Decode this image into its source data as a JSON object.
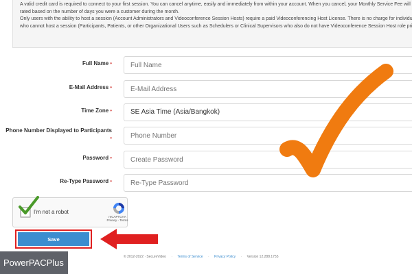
{
  "notice": {
    "line1": "A valid credit card is required to connect to your first session. You can cancel anytime, easily and immediately from within your account. When you cancel, your Monthly Service Fee will",
    "line2": "rated based on the number of days you were a customer during the month.",
    "line3": "Only users with the ability to host a session (Account Administrators and Videoconference Session Hosts) require a paid Videoconferencing Host License. There is no charge for individua",
    "line4": "who cannot host a session (Participants, Patients, or other Organizational Users such as Schedulers or Clinical Supervisors who also do not have Videoconference Session Host role privil"
  },
  "form": {
    "required_mark": "•",
    "fields": [
      {
        "label": "Full Name",
        "placeholder": "Full Name"
      },
      {
        "label": "E-Mail Address",
        "placeholder": "E-Mail Address"
      },
      {
        "label": "Time Zone",
        "value": "SE Asia Time (Asia/Bangkok)"
      },
      {
        "label": "Phone Number Displayed to Participants",
        "placeholder": "Phone Number"
      },
      {
        "label": "Password",
        "placeholder": "Create Password"
      },
      {
        "label": "Re-Type Password",
        "placeholder": "Re-Type Password"
      }
    ]
  },
  "captcha": {
    "label": "I'm not a robot",
    "brand": "reCAPTCHA",
    "links": "Privacy - Terms"
  },
  "save_button": {
    "label": "Save"
  },
  "footer": {
    "copyright": "© 2012-2022 · SecureVideo",
    "terms": "Terms of Service",
    "privacy": "Privacy Policy",
    "version": "Version 12.288.1755"
  },
  "watermark": {
    "text": "PowerPACPlus"
  },
  "colors": {
    "accent": "#3c8dcf",
    "annotation_red": "#e02020",
    "checkmark_orange": "#f07b10",
    "checkmark_green": "#4a9a2a"
  }
}
